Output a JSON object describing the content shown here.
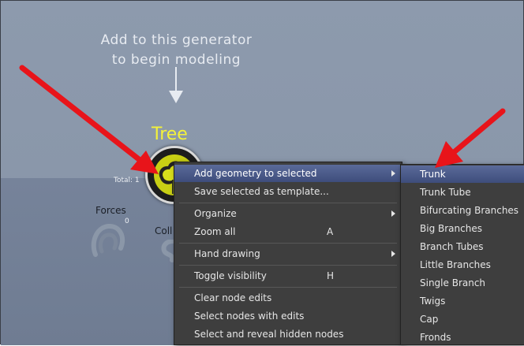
{
  "canvas": {
    "hint_line1": "Add to this generator",
    "hint_line2": "to begin modeling",
    "tree_label": "Tree",
    "total_label": "Total: 1",
    "forces_label": "Forces",
    "forces_count": "0",
    "collision_label": "Coll"
  },
  "context_menu": {
    "items": [
      {
        "label": "Add geometry to selected",
        "submenu": true,
        "highlighted": true
      },
      {
        "label": "Save selected as template..."
      },
      {
        "label": "Organize",
        "submenu": true
      },
      {
        "label": "Zoom all",
        "shortcut": "A"
      },
      {
        "label": "Hand drawing",
        "submenu": true
      },
      {
        "label": "Toggle visibility",
        "shortcut": "H"
      },
      {
        "label": "Clear node edits"
      },
      {
        "label": "Select nodes with edits"
      },
      {
        "label": "Select and reveal hidden nodes"
      }
    ]
  },
  "geometry_submenu": {
    "items": [
      {
        "label": "Trunk",
        "highlighted": true
      },
      {
        "label": "Trunk Tube"
      },
      {
        "label": "Bifurcating Branches"
      },
      {
        "label": "Big Branches"
      },
      {
        "label": "Branch Tubes"
      },
      {
        "label": "Little Branches"
      },
      {
        "label": "Single Branch"
      },
      {
        "label": "Twigs"
      },
      {
        "label": "Cap"
      },
      {
        "label": "Fronds"
      }
    ]
  },
  "colors": {
    "canvas_bg": "#8a97aa",
    "menu_bg": "#3e3e3e",
    "highlight": "#4a5a8a",
    "tree_label": "#f4f23a",
    "annotation_arrow": "#e8141a"
  },
  "icons": [
    "tree-generator-icon",
    "forces-magnet-icon",
    "collision-icon",
    "submenu-arrow-icon",
    "down-arrow-icon"
  ]
}
